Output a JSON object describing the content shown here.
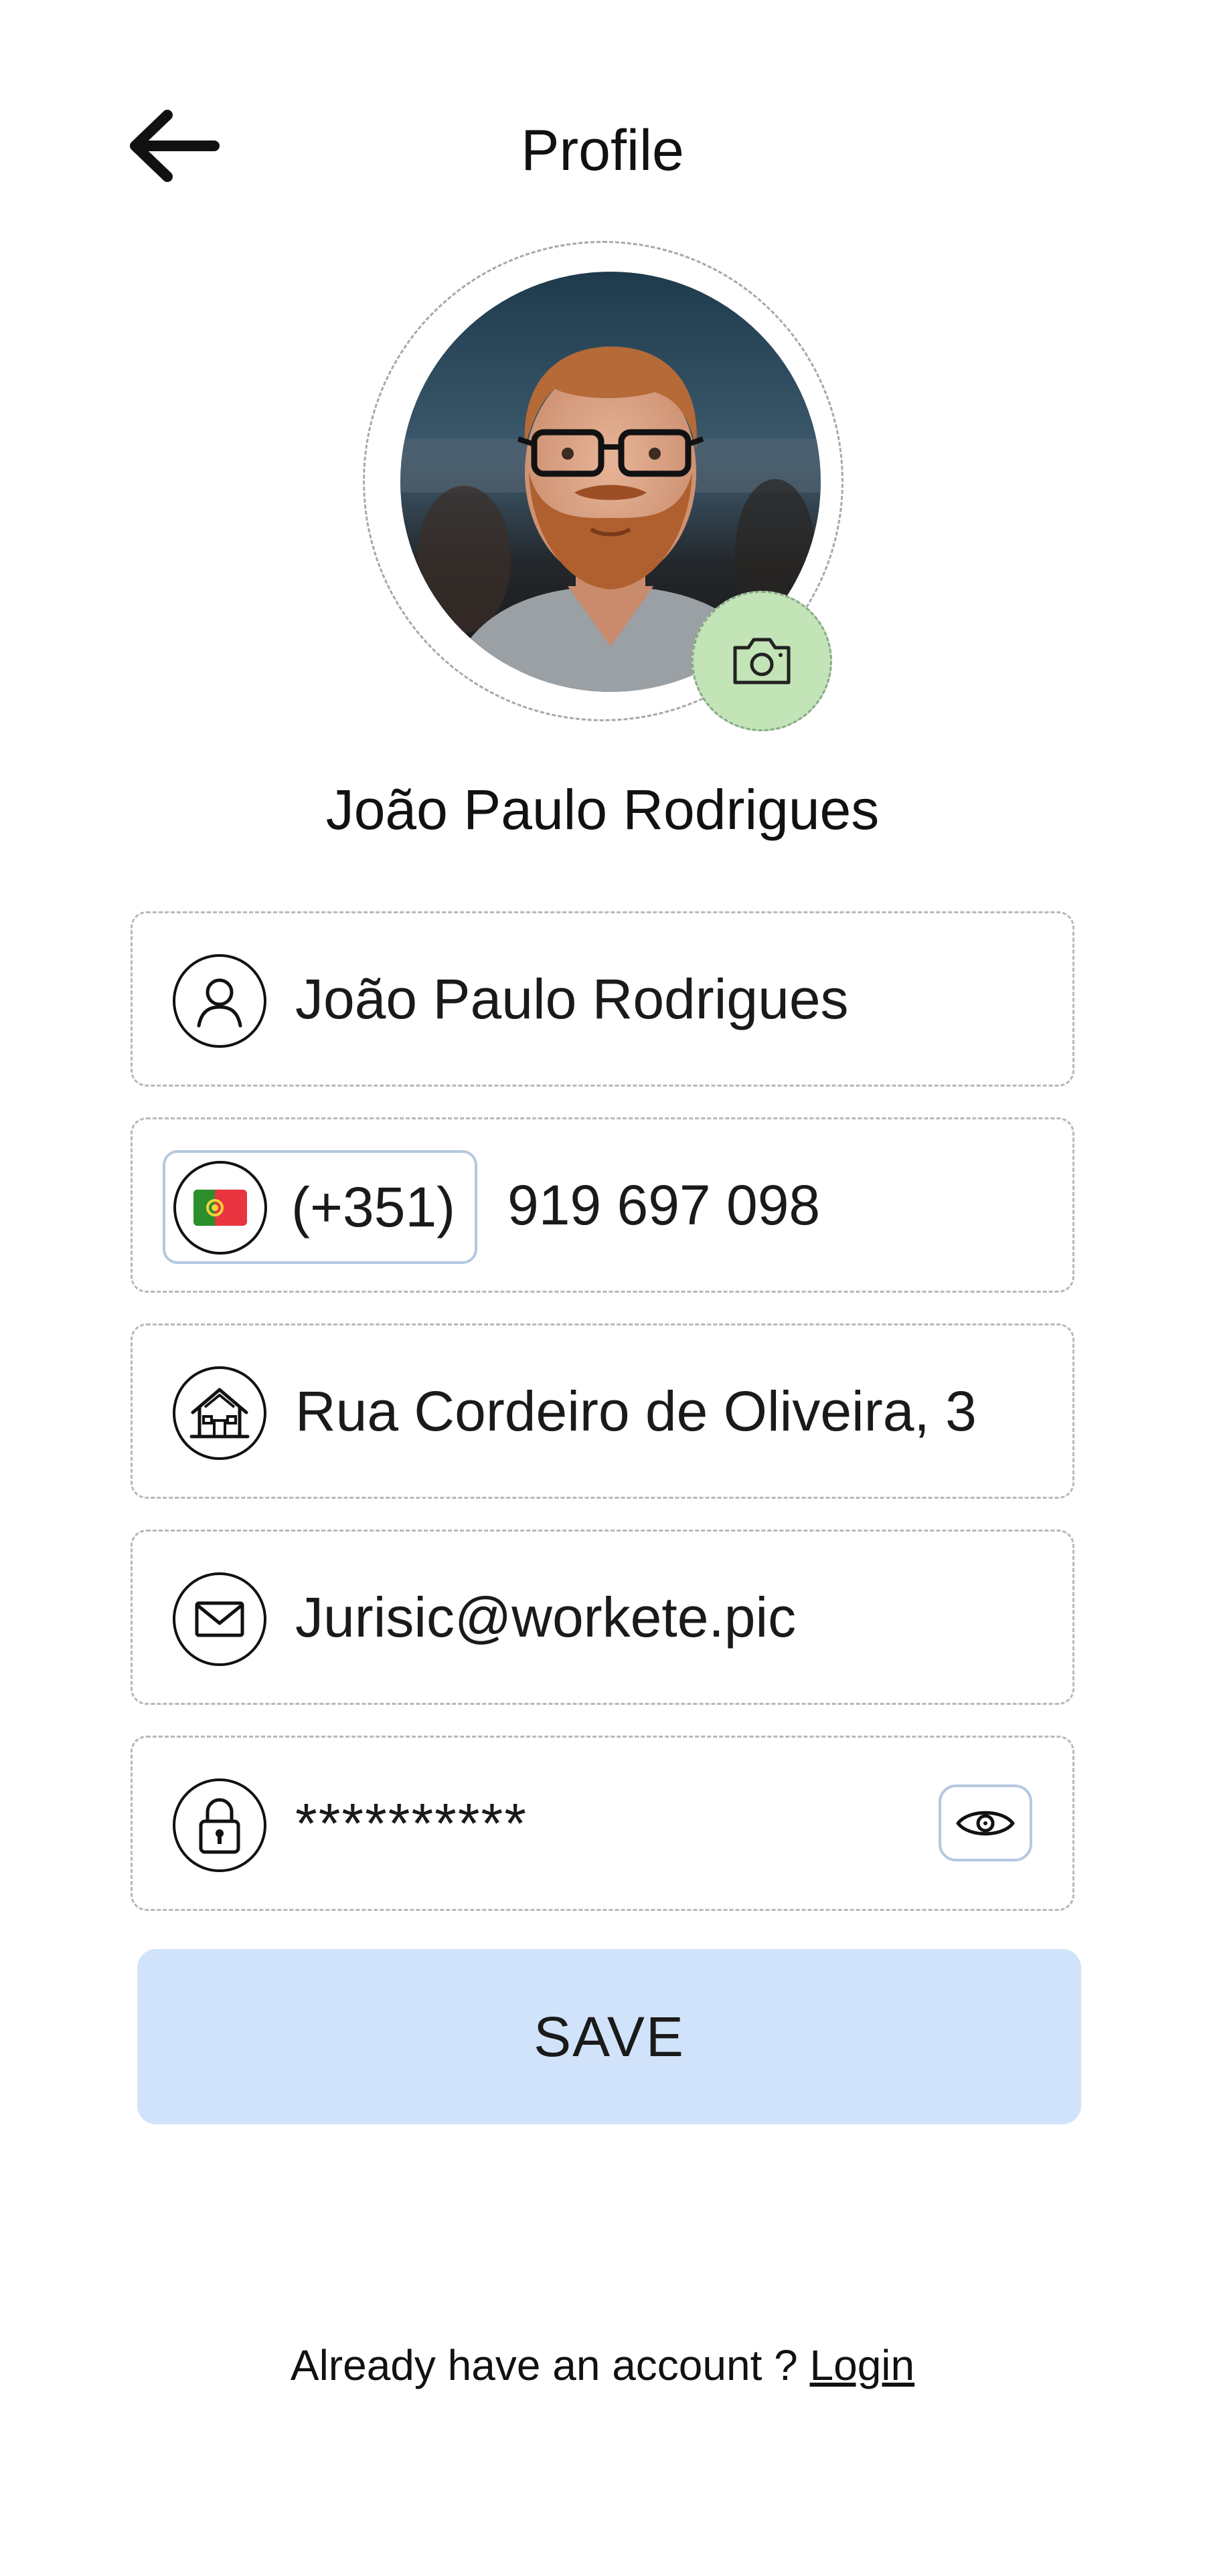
{
  "header": {
    "title": "Profile"
  },
  "profile": {
    "display_name": "João Paulo Rodrigues"
  },
  "form": {
    "name_value": "João Paulo Rodrigues",
    "country_code": "(+351)",
    "phone_value": "919 697 098",
    "address_value": "Rua Cordeiro de Oliveira, 3",
    "email_value": "Jurisic@workete.pic",
    "password_value": "**********"
  },
  "actions": {
    "save_label": "SAVE"
  },
  "footer": {
    "prompt_text": "Already have an account ?",
    "login_label": "Login"
  },
  "colors": {
    "camera_button": "#c3e4b6",
    "save_button": "#d1e3fa",
    "outline_accent": "#b5c8e0"
  },
  "icons": {
    "back": "arrow-left-icon",
    "camera": "camera-icon",
    "name": "user-icon",
    "country": "portugal-flag-icon",
    "address": "house-icon",
    "email": "envelope-icon",
    "password": "lock-icon",
    "toggle_password": "eye-icon"
  }
}
